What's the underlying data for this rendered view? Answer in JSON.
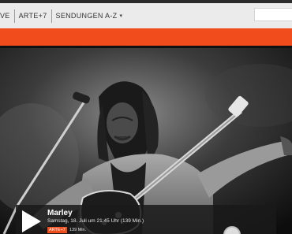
{
  "nav": {
    "items": [
      {
        "label": "VE"
      },
      {
        "label": "ARTE+7"
      },
      {
        "label": "SENDUNGEN A-Z"
      }
    ],
    "chevron": "▾"
  },
  "search": {
    "placeholder": ""
  },
  "hero": {
    "icon": "play-icon",
    "title": "Marley",
    "schedule": "Samstag, 18. Juli um 21:45 Uhr (139 Min.)",
    "badge": "ARTE+7",
    "duration": "139 Min."
  },
  "colors": {
    "accent": "#f04c1c",
    "nav_bg": "#ebebeb",
    "photo": "grayscale"
  }
}
